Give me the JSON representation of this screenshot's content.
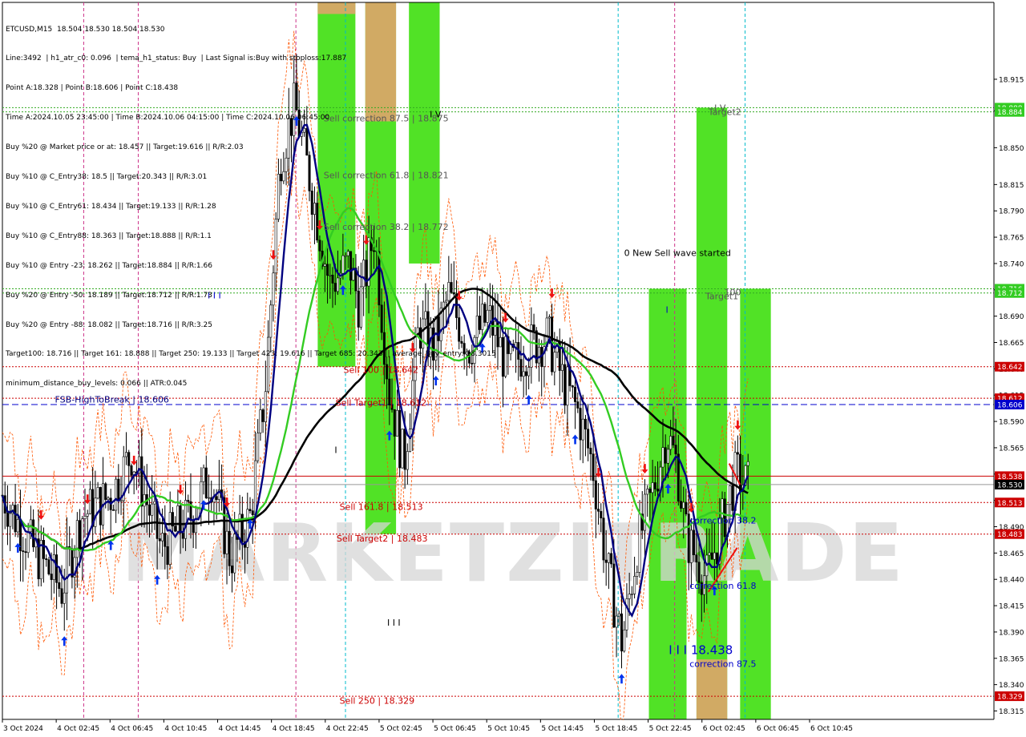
{
  "header": {
    "lines": [
      "ETCUSD,M15  18.504 18.530 18.504 18.530",
      "Line:3492  | h1_atr_c0: 0.096  | tema_h1_status: Buy  | Last Signal is:Buy with stoploss:17.887",
      "Point A:18.328 | Point B:18.606 | Point C:18.438",
      "Time A:2024.10.05 23:45:00 | Time B:2024.10.06 04:15:00 | Time C:2024.10.06 06:45:00",
      "Buy %20 @ Market price or at: 18.457 || Target:19.616 || R/R:2.03",
      "Buy %10 @ C_Entry38: 18.5 || Target:20.343 || R/R:3.01",
      "Buy %10 @ C_Entry61: 18.434 || Target:19.133 || R/R:1.28",
      "Buy %10 @ C_Entry88: 18.363 || Target:18.888 || R/R:1.1",
      "Buy %10 @ Entry -23: 18.262 || Target:18.884 || R/R:1.66",
      "Buy %20 @ Entry -50: 18.189 || Target:18.712 || R/R:1.73",
      "Buy %20 @ Entry -88: 18.082 || Target:18.716 || R/R:3.25",
      "Target100: 18.716 || Target 161: 18.888 || Target 250: 19.133 || Target 423: 19.616 || Target 685: 20.343 || average_Buy_entry: 18.3015",
      "minimum_distance_buy_levels: 0.066 || ATR:0.045"
    ]
  },
  "watermark": "MARKETZITRADE",
  "colors": {
    "background": "#ffffff",
    "grid": "#c8c8c8",
    "candle_up": "#000000",
    "candle_down": "#000000",
    "green_zone": "#33dd00",
    "orange_zone": "#e8a070",
    "ma_fast": "#000080",
    "ma_mid": "#33cc22",
    "ma_slow": "#000000",
    "sell_level": "#cc0000",
    "blue_line": "#0000cc",
    "envelope": "#ff5500"
  },
  "chart_data": {
    "type": "candlestick",
    "symbol": "ETCUSD",
    "timeframe": "M15",
    "ylim": [
      18.307,
      18.988
    ],
    "y_ticks": [
      "18.915",
      "18.885",
      "18.850",
      "18.815",
      "18.790",
      "18.765",
      "18.740",
      "18.715",
      "18.690",
      "18.665",
      "18.640",
      "18.615",
      "18.590",
      "18.565",
      "18.540",
      "18.515",
      "18.490",
      "18.465",
      "18.440",
      "18.415",
      "18.390",
      "18.365",
      "18.340",
      "18.315"
    ],
    "x_ticks": [
      "3 Oct 2024",
      "4 Oct 02:45",
      "4 Oct 06:45",
      "4 Oct 10:45",
      "4 Oct 14:45",
      "4 Oct 18:45",
      "4 Oct 22:45",
      "5 Oct 02:45",
      "5 Oct 06:45",
      "5 Oct 10:45",
      "5 Oct 14:45",
      "5 Oct 18:45",
      "5 Oct 22:45",
      "6 Oct 02:45",
      "6 Oct 06:45",
      "6 Oct 10:45"
    ],
    "price_badges": [
      {
        "label": "18.888",
        "value": 18.888,
        "color": "#33cc22"
      },
      {
        "label": "18.884",
        "value": 18.884,
        "color": "#33cc22"
      },
      {
        "label": "18.716",
        "value": 18.716,
        "color": "#33cc22"
      },
      {
        "label": "18.712",
        "value": 18.712,
        "color": "#33cc22"
      },
      {
        "label": "18.642",
        "value": 18.642,
        "color": "#cc0000"
      },
      {
        "label": "18.612",
        "value": 18.612,
        "color": "#cc0000"
      },
      {
        "label": "18.606",
        "value": 18.606,
        "color": "#0000cc"
      },
      {
        "label": "18.538",
        "value": 18.538,
        "color": "#cc0000"
      },
      {
        "label": "18.530",
        "value": 18.53,
        "color": "#000000"
      },
      {
        "label": "18.513",
        "value": 18.513,
        "color": "#cc0000"
      },
      {
        "label": "18.483",
        "value": 18.483,
        "color": "#cc0000"
      },
      {
        "label": "18.329",
        "value": 18.329,
        "color": "#cc0000"
      }
    ],
    "hlines": [
      {
        "value": 18.888,
        "color": "#33aa22",
        "style": "dotted"
      },
      {
        "value": 18.884,
        "color": "#33aa22",
        "style": "dotted"
      },
      {
        "value": 18.716,
        "color": "#33aa22",
        "style": "dotted"
      },
      {
        "value": 18.712,
        "color": "#33aa22",
        "style": "dotted"
      },
      {
        "value": 18.642,
        "color": "#cc0000",
        "style": "dotted"
      },
      {
        "value": 18.612,
        "color": "#cc0000",
        "style": "dotted"
      },
      {
        "value": 18.606,
        "color": "#0000cc",
        "style": "dashed"
      },
      {
        "value": 18.538,
        "color": "#cc0000",
        "style": "solid"
      },
      {
        "value": 18.53,
        "color": "#999999",
        "style": "solid"
      },
      {
        "value": 18.513,
        "color": "#cc0000",
        "style": "dotted"
      },
      {
        "value": 18.483,
        "color": "#cc0000",
        "style": "dotted"
      },
      {
        "value": 18.329,
        "color": "#cc0000",
        "style": "dotted"
      }
    ],
    "zones": [
      {
        "x0": 0.318,
        "x1": 0.356,
        "y0": 18.642,
        "y1": 18.988,
        "color": "green"
      },
      {
        "x0": 0.318,
        "x1": 0.356,
        "y0": 18.977,
        "y1": 18.988,
        "color": "orange"
      },
      {
        "x0": 0.366,
        "x1": 0.397,
        "y0": 18.483,
        "y1": 18.988,
        "color": "green"
      },
      {
        "x0": 0.366,
        "x1": 0.397,
        "y0": 18.875,
        "y1": 18.988,
        "color": "orange"
      },
      {
        "x0": 0.41,
        "x1": 0.441,
        "y0": 18.74,
        "y1": 18.988,
        "color": "green"
      },
      {
        "x0": 0.652,
        "x1": 0.69,
        "y0": 18.307,
        "y1": 18.716,
        "color": "green"
      },
      {
        "x0": 0.7,
        "x1": 0.731,
        "y0": 18.307,
        "y1": 18.888,
        "color": "green"
      },
      {
        "x0": 0.7,
        "x1": 0.731,
        "y0": 18.307,
        "y1": 18.364,
        "color": "orange"
      },
      {
        "x0": 0.744,
        "x1": 0.775,
        "y0": 18.307,
        "y1": 18.716,
        "color": "green"
      }
    ],
    "labels": [
      {
        "text": "Sell correction 87.5 | 18.875",
        "x": 0.324,
        "y": 18.875,
        "color": "#555555"
      },
      {
        "text": "Sell correction 61.8 | 18.821",
        "x": 0.324,
        "y": 18.821,
        "color": "#555555"
      },
      {
        "text": "Sell correction 38.2 | 18.772",
        "x": 0.324,
        "y": 18.772,
        "color": "#555555"
      },
      {
        "text": "Sell 100 | 18.642",
        "x": 0.344,
        "y": 18.636,
        "color": "#cc0000"
      },
      {
        "text": "Sell Target1 | 18.612",
        "x": 0.336,
        "y": 18.605,
        "color": "#cc0000"
      },
      {
        "text": "FSB-HighToBreak | 18.606",
        "x": 0.053,
        "y": 18.608,
        "color": "#000080"
      },
      {
        "text": "Sell 161.8 | 18.513",
        "x": 0.34,
        "y": 18.506,
        "color": "#cc0000"
      },
      {
        "text": "Sell Target2 | 18.483",
        "x": 0.337,
        "y": 18.476,
        "color": "#cc0000"
      },
      {
        "text": "Sell 250 | 18.329",
        "x": 0.34,
        "y": 18.322,
        "color": "#cc0000"
      },
      {
        "text": "0 New Sell wave started",
        "x": 0.627,
        "y": 18.747,
        "color": "#000000"
      },
      {
        "text": "Target2",
        "x": 0.712,
        "y": 18.881,
        "color": "#555555"
      },
      {
        "text": "Target1",
        "x": 0.709,
        "y": 18.706,
        "color": "#555555"
      },
      {
        "text": "correction 38.2",
        "x": 0.693,
        "y": 18.493,
        "color": "#0000cc"
      },
      {
        "text": "correction 61.8",
        "x": 0.693,
        "y": 18.431,
        "color": "#0000cc"
      },
      {
        "text": "correction 87.5",
        "x": 0.693,
        "y": 18.357,
        "color": "#0000cc"
      },
      {
        "text": "I I I 18.438",
        "x": 0.672,
        "y": 18.369,
        "color": "#0000cc"
      },
      {
        "text": "I V",
        "x": 0.431,
        "y": 18.879,
        "color": "#000000"
      },
      {
        "text": "I I I",
        "x": 0.207,
        "y": 18.707,
        "color": "#0000cc"
      },
      {
        "text": "I I I",
        "x": 0.388,
        "y": 18.396,
        "color": "#000000"
      },
      {
        "text": "I",
        "x": 0.335,
        "y": 18.56,
        "color": "#000000"
      },
      {
        "text": "I",
        "x": 0.669,
        "y": 18.693,
        "color": "#0000cc"
      },
      {
        "text": "I V",
        "x": 0.718,
        "y": 18.885,
        "color": "#555555"
      },
      {
        "text": "100",
        "x": 0.728,
        "y": 18.71,
        "color": "#555555"
      }
    ]
  }
}
